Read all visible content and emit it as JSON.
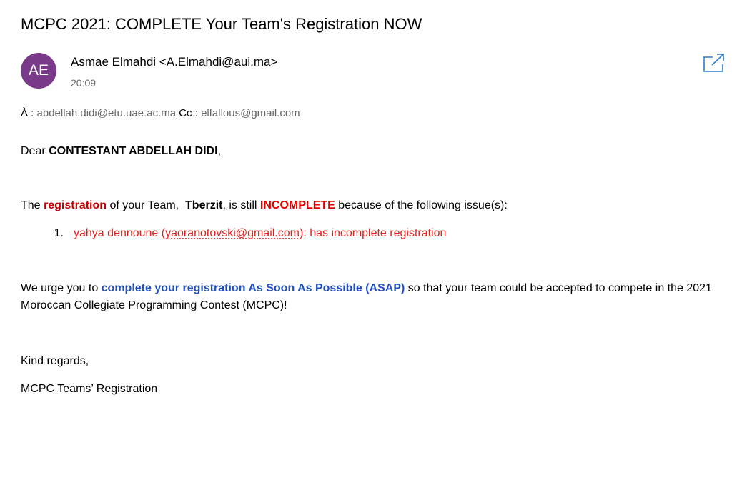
{
  "email": {
    "subject": "MCPC 2021: COMPLETE Your Team's Registration NOW",
    "sender": {
      "initials": "AE",
      "name_line": "Asmae Elmahdi <A.Elmahdi@aui.ma>",
      "time": "20:09",
      "avatar_color": "#7a3a8a"
    },
    "to_label": "À :",
    "to_address": "abdellah.didi@etu.uae.ac.ma",
    "cc_label": "Cc :",
    "cc_address": "elfallous@gmail.com",
    "popout_icon": "popout-icon"
  },
  "body": {
    "greeting_prefix": "Dear ",
    "greeting_name": "CONTESTANT ABDELLAH DIDI",
    "greeting_suffix": ",",
    "team_p1": "The ",
    "team_registration": "registration",
    "team_p2": " of your Team,  ",
    "team_name": "Tberzit",
    "team_p3": ", is still ",
    "team_incomplete": "INCOMPLETE",
    "team_p4": " because of the following issue(s):",
    "issues": [
      {
        "number": "1.",
        "name_prefix": "yahya dennoune (",
        "email": "yaoranotovski@gmail.com",
        "suffix": "): has incomplete registration"
      }
    ],
    "urge_p1": "We urge you to ",
    "urge_highlight": "complete your registration As Soon As Possible (ASAP)",
    "urge_p2": " so that your team could be accepted to compete in the 2021 Moroccan Collegiate Programming Contest (MCPC)!",
    "regards": "Kind regards,",
    "signature": "MCPC Teams’ Registration"
  },
  "colors": {
    "registration": "#c00000",
    "incomplete": "#e00000",
    "issue": "#e32020",
    "asap": "#1f4fc0",
    "meta_gray": "#666666"
  }
}
